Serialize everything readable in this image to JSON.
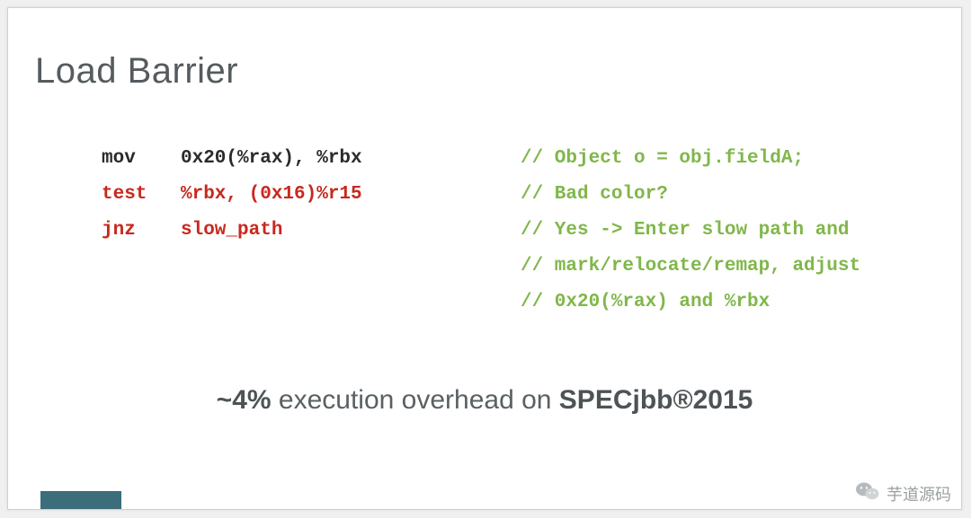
{
  "title": "Load Barrier",
  "code": [
    {
      "mnemonic": "mov",
      "operands": "0x20(%rax), %rbx",
      "color": "black"
    },
    {
      "mnemonic": "test",
      "operands": "%rbx, (0x16)%r15",
      "color": "red"
    },
    {
      "mnemonic": "jnz",
      "operands": "slow_path",
      "color": "red"
    }
  ],
  "comments": [
    "// Object o = obj.fieldA;",
    "// Bad color?",
    "// Yes -> Enter slow path and",
    "// mark/relocate/remap, adjust",
    "// 0x20(%rax) and %rbx"
  ],
  "summary": {
    "pct": "~4%",
    "mid": " execution overhead on ",
    "benchmark": "SPECjbb®2015"
  },
  "watermark": "芋道源码"
}
